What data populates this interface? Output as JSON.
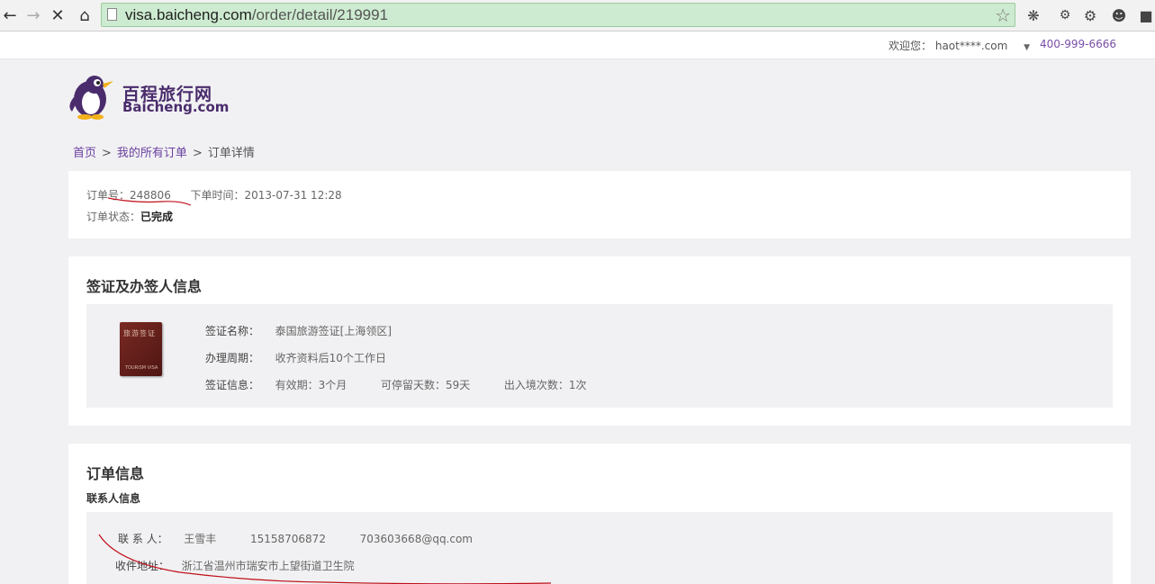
{
  "browser": {
    "url_host": "visa.baicheng.com",
    "url_path": "/order/detail/219991"
  },
  "topbar": {
    "welcome_label": "欢迎您：",
    "username": "haot****.com",
    "phone": "400-999-6666"
  },
  "logo": {
    "cn": "百程旅行网",
    "en": "Baicheng.com"
  },
  "breadcrumb": {
    "home": "首页",
    "orders": "我的所有订单",
    "current": "订单详情",
    "separator": ">"
  },
  "order_summary": {
    "order_no_label": "订单号：",
    "order_no": "248806",
    "order_time_label": "下单时间：",
    "order_time": "2013-07-31 12:28",
    "status_label": "订单状态：",
    "status": "已完成"
  },
  "visa_section": {
    "title": "签证及办签人信息",
    "book_cn": "旅游签证",
    "book_en": "TOURISM VISA",
    "name_label": "签证名称：",
    "name": "泰国旅游签证[上海领区]",
    "period_label": "办理周期：",
    "period": "收齐资料后10个工作日",
    "info_label": "签证信息：",
    "validity": "有效期：3个月",
    "stay": "可停留天数：59天",
    "entries": "出入境次数：1次"
  },
  "order_info": {
    "title": "订单信息",
    "contact_title": "联系人信息",
    "contact_label": "联 系 人：",
    "contact_name": "王雪丰",
    "contact_phone": "15158706872",
    "contact_email": "703603668@qq.com",
    "address_label": "收件地址：",
    "address": "浙江省温州市瑞安市上望街道卫生院"
  },
  "colors": {
    "brand": "#4a2c6c",
    "link": "#6a3fa0",
    "annotation": "#c0101a",
    "urlbar": "#cdebd0"
  }
}
